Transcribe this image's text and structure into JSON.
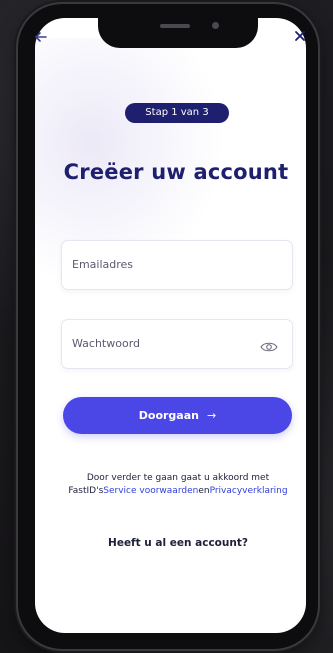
{
  "header": {
    "back_icon": "arrow-left-icon",
    "close_icon": "close-icon"
  },
  "step": {
    "label": "Stap 1 van 3"
  },
  "title": "Creëer uw account",
  "form": {
    "email_placeholder": "Emailadres",
    "password_placeholder": "Wachtwoord",
    "password_toggle_icon": "eye-icon",
    "submit_label": "Doorgaan",
    "submit_icon": "arrow-right-icon"
  },
  "terms": {
    "prefix": "Door verder te gaan gaat u akkoord met FastID's",
    "service_link": "Service voorwaarden",
    "connector": "en",
    "privacy_link": "Privacyverklaring"
  },
  "login_prompt": "Heeft u al een account?",
  "colors": {
    "primary": "#4b46e6",
    "navy": "#1e1f6e",
    "link": "#2f3fd8",
    "background": "#1b1a1d"
  }
}
